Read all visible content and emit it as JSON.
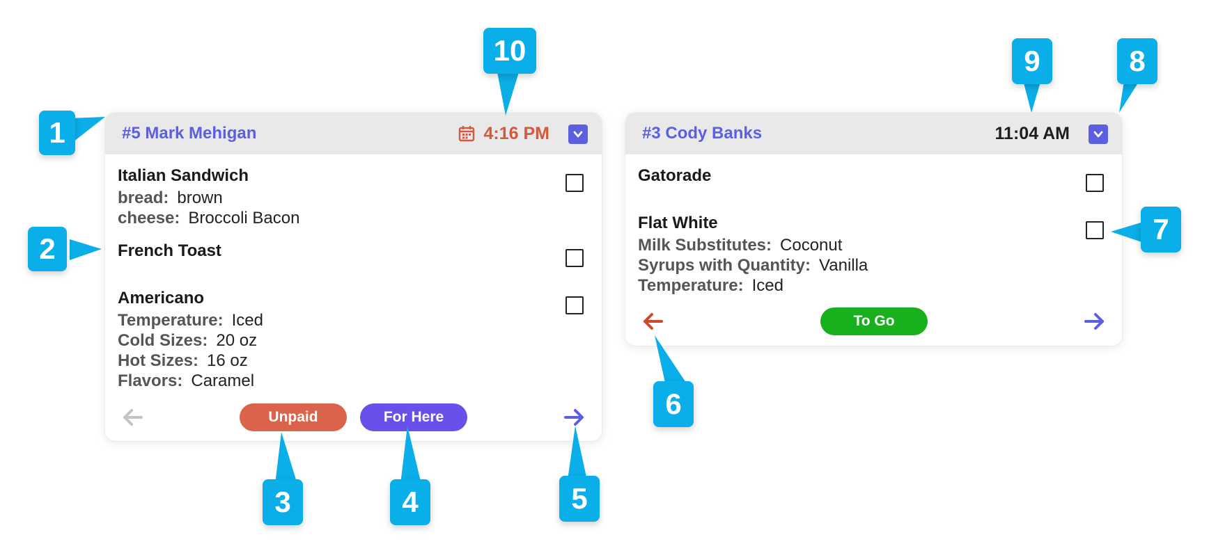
{
  "cards": [
    {
      "title": "#5 Mark Mehigan",
      "time": "4:16 PM",
      "time_status": "late",
      "items": [
        {
          "name": "Italian Sandwich",
          "modifiers": [
            {
              "key": "bread:",
              "value": "brown"
            },
            {
              "key": "cheese:",
              "value": "Broccoli Bacon"
            }
          ]
        },
        {
          "name": "French Toast",
          "modifiers": []
        },
        {
          "name": "Americano",
          "modifiers": [
            {
              "key": "Temperature:",
              "value": "Iced"
            },
            {
              "key": "Cold Sizes:",
              "value": "20 oz"
            },
            {
              "key": "Hot Sizes:",
              "value": "16 oz"
            },
            {
              "key": "Flavors:",
              "value": "Caramel"
            }
          ]
        }
      ],
      "badges": [
        {
          "label": "Unpaid",
          "color": "#dc634b"
        },
        {
          "label": "For Here",
          "color": "#6a50ea"
        }
      ],
      "prev_arrow_color": "#c4c4c4",
      "next_arrow_color": "#5b5fe0"
    },
    {
      "title": "#3 Cody Banks",
      "time": "11:04 AM",
      "time_status": "normal",
      "items": [
        {
          "name": "Gatorade",
          "modifiers": []
        },
        {
          "name": "Flat White",
          "modifiers": [
            {
              "key": "Milk Substitutes:",
              "value": "Coconut"
            },
            {
              "key": "Syrups with Quantity:",
              "value": "Vanilla"
            },
            {
              "key": "Temperature:",
              "value": "Iced"
            }
          ]
        }
      ],
      "badges": [
        {
          "label": "To Go",
          "color": "#18b01c"
        }
      ],
      "prev_arrow_color": "#d04a2a",
      "next_arrow_color": "#5b5fe0"
    }
  ],
  "colors": {
    "accent": "#5b5fe0",
    "late": "#d35a40",
    "header_bg": "#e9e9e9",
    "callout": "#0aaee8"
  },
  "icons": {
    "calendar": "calendar-icon",
    "dropdown": "chevron-down-icon",
    "prev": "arrow-left-icon",
    "next": "arrow-right-icon"
  },
  "callouts": [
    "1",
    "2",
    "3",
    "4",
    "5",
    "6",
    "7",
    "8",
    "9",
    "10"
  ]
}
